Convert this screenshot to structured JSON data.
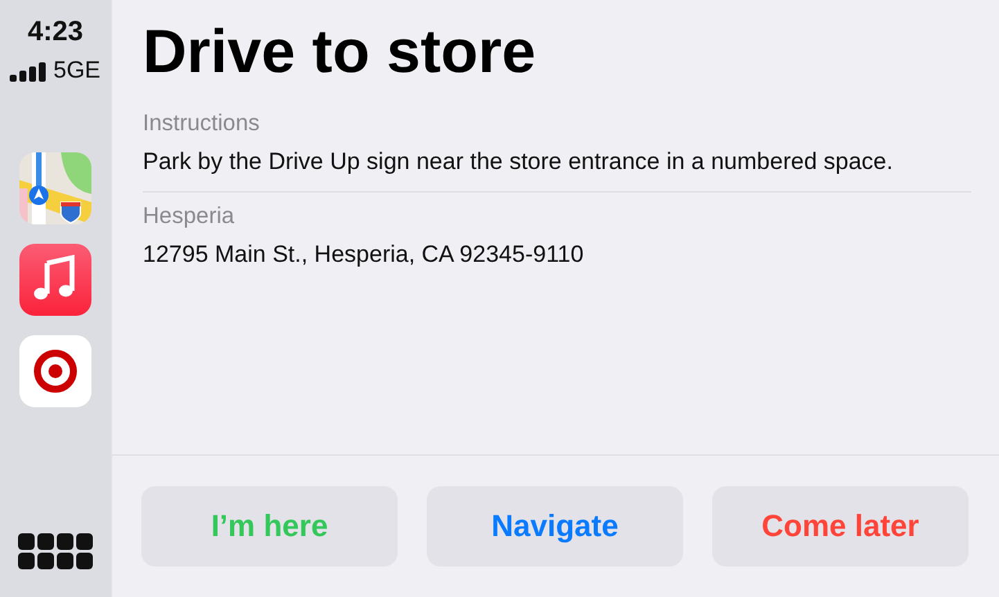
{
  "status_bar": {
    "time": "4:23",
    "network": "5GE"
  },
  "dock": {
    "apps": [
      {
        "kind": "maps"
      },
      {
        "kind": "music"
      },
      {
        "kind": "target"
      }
    ]
  },
  "title": "Drive to store",
  "sections": [
    {
      "label": "Instructions",
      "value": "Park by the Drive Up sign near the store entrance in a numbered space."
    },
    {
      "label": "Hesperia",
      "value": "12795 Main St., Hesperia, CA 92345-9110"
    }
  ],
  "buttons": [
    {
      "label": "I’m here",
      "color": "#34c759"
    },
    {
      "label": "Navigate",
      "color": "#0a7aff"
    },
    {
      "label": "Come later",
      "color": "#ff453a"
    }
  ]
}
